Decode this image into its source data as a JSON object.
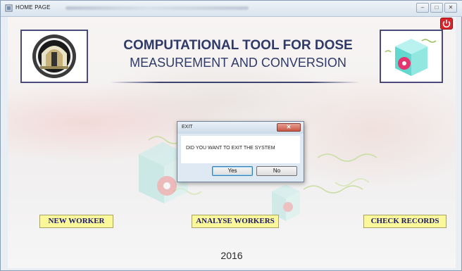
{
  "window": {
    "title": "HOME PAGE",
    "controls": {
      "minimize": "–",
      "maximize": "□",
      "close": "✕"
    }
  },
  "header": {
    "title_line1": "COMPUTATIONAL TOOL FOR DOSE",
    "title_line2": "MEASUREMENT AND CONVERSION",
    "accent_color": "#2f3a68"
  },
  "icons": {
    "app": "app-icon",
    "university_logo": "university-crest-icon",
    "radiation_cube": "radiation-cube-icon",
    "power": "power-icon"
  },
  "nav": {
    "new_worker": "NEW WORKER",
    "analyse_workers": "ANALYSE WORKERS",
    "check_records": "CHECK RECORDS",
    "button_color": "#fbf79b"
  },
  "footer": {
    "year": "2016"
  },
  "dialog": {
    "title": "EXIT",
    "close": "✕",
    "message": "DID YOU WANT TO EXIT THE SYSTEM",
    "yes": "Yes",
    "no": "No"
  }
}
